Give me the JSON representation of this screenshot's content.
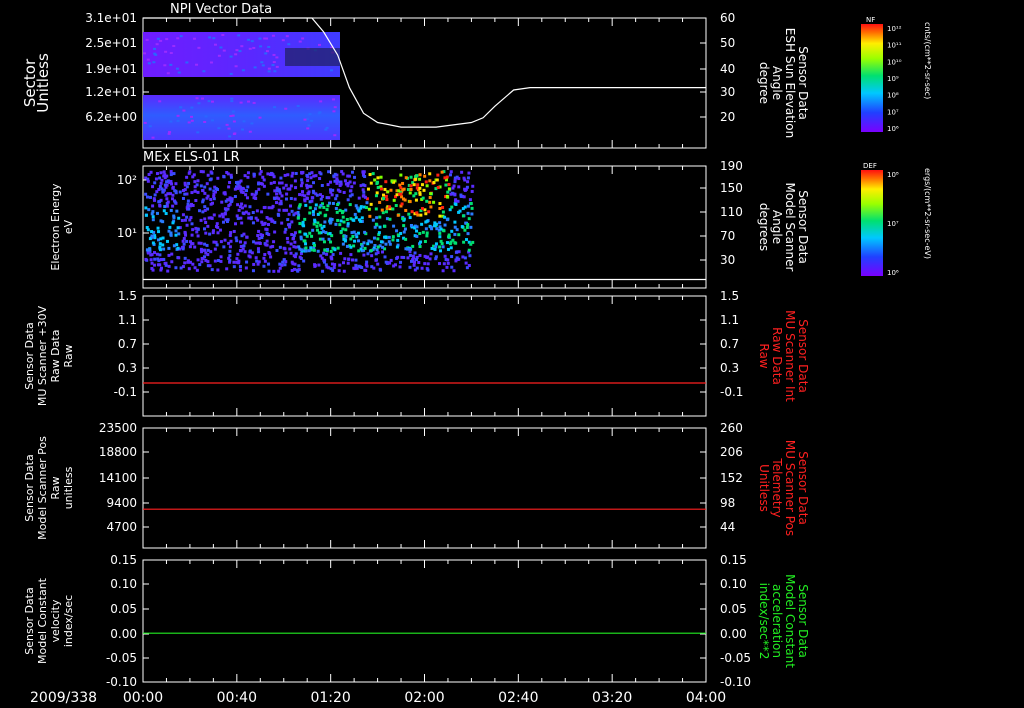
{
  "date_label": "2009/338",
  "time_axis": {
    "ticks": [
      "00:00",
      "00:40",
      "01:20",
      "02:00",
      "02:40",
      "03:20",
      "04:00"
    ],
    "range_minutes": [
      0,
      240
    ]
  },
  "colors": {
    "background": "#000000",
    "axes": "#ffffff",
    "red": "#ff2020",
    "green": "#22ee22"
  },
  "chart_data": [
    {
      "type": "heatmap",
      "title": "NPI Vector Data",
      "ylabel": [
        "Sector",
        "Unitless"
      ],
      "left_ticks": [
        "3.1e+01",
        "2.5e+01",
        "1.9e+01",
        "1.2e+01",
        "6.2e+00"
      ],
      "right_ylabel": [
        "Sensor Data",
        "ESH Sun Elevation",
        "Angle",
        "degree"
      ],
      "right_ticks": [
        "60",
        "50",
        "40",
        "30",
        "20"
      ],
      "right_ylim": [
        12,
        60
      ],
      "overlay_line": {
        "t": [
          0,
          72,
          77,
          83,
          88,
          94,
          100,
          110,
          125,
          140,
          145,
          150,
          158,
          165,
          172,
          240
        ],
        "values": [
          60,
          60,
          54,
          44,
          30,
          19,
          15,
          13,
          13,
          15,
          17,
          22,
          29,
          30,
          30,
          30
        ]
      },
      "colorbar": {
        "label": "NF",
        "ticks": [
          "10¹²",
          "10¹¹",
          "10¹⁰",
          "10⁹",
          "10⁸",
          "10⁷",
          "10⁶"
        ],
        "unit": "cnts/(cm**2-sr-sec)"
      }
    },
    {
      "type": "heatmap",
      "title": "MEx ELS-01 LR",
      "ylabel": [
        "Electron Energy",
        "eV"
      ],
      "left_ticks": [
        "10²",
        "10¹"
      ],
      "yscale": "log",
      "right_ylabel": [
        "Sensor Data",
        "Model Scanner",
        "Angle",
        "degrees"
      ],
      "right_ticks": [
        "190",
        "150",
        "110",
        "70",
        "30"
      ],
      "right_ylim": [
        0,
        190
      ],
      "overlay_line": {
        "t": [
          0,
          240
        ],
        "values": [
          2,
          2
        ]
      },
      "colorbar": {
        "label": "DEF",
        "ticks": [
          "10⁸",
          "10⁷",
          "10⁶"
        ],
        "unit": "ergs/(cm**2-sr-sec-eV)"
      }
    },
    {
      "type": "line",
      "ylabel": [
        "Sensor Data",
        "MU Scanner +30V",
        "Raw Data",
        "Raw"
      ],
      "left_ticks": [
        "1.5",
        "1.1",
        "0.7",
        "0.3",
        "-0.1"
      ],
      "ylim": [
        -0.5,
        1.5
      ],
      "right_ylabel": [
        "Sensor Data",
        "MU Scanner Int",
        "Raw Data",
        "Raw"
      ],
      "right_ticks": [
        "1.5",
        "1.1",
        "0.7",
        "0.3",
        "-0.1"
      ],
      "series": [
        {
          "t": [
            0,
            240
          ],
          "values": [
            0.05,
            0.05
          ]
        }
      ]
    },
    {
      "type": "line",
      "ylabel": [
        "Sensor Data",
        "Model Scanner Pos",
        "Raw",
        "unitless"
      ],
      "left_ticks": [
        "23500",
        "18800",
        "14100",
        "9400",
        "4700"
      ],
      "ylim": [
        0,
        23500
      ],
      "right_ylabel": [
        "Sensor Data",
        "MU Scanner Pos",
        "Telemetry",
        "Unitless"
      ],
      "right_ticks": [
        "260",
        "206",
        "152",
        "98",
        "44"
      ],
      "series": [
        {
          "t": [
            0,
            240
          ],
          "values": [
            7600,
            7600
          ]
        }
      ]
    },
    {
      "type": "line",
      "ylabel": [
        "Sensor Data",
        "Model Constant",
        "velocity",
        "index/sec"
      ],
      "left_ticks": [
        "0.15",
        "0.10",
        "0.05",
        "0.00",
        "-0.05",
        "-0.10"
      ],
      "ylim": [
        -0.1,
        0.15
      ],
      "right_ylabel": [
        "Sensor Data",
        "Model Constant",
        "acceleration",
        "index/sec**2"
      ],
      "right_ticks": [
        "0.15",
        "0.10",
        "0.05",
        "0.00",
        "-0.05",
        "-0.10"
      ],
      "series": [
        {
          "t": [
            0,
            240
          ],
          "values": [
            0.0,
            0.0
          ]
        }
      ]
    }
  ]
}
